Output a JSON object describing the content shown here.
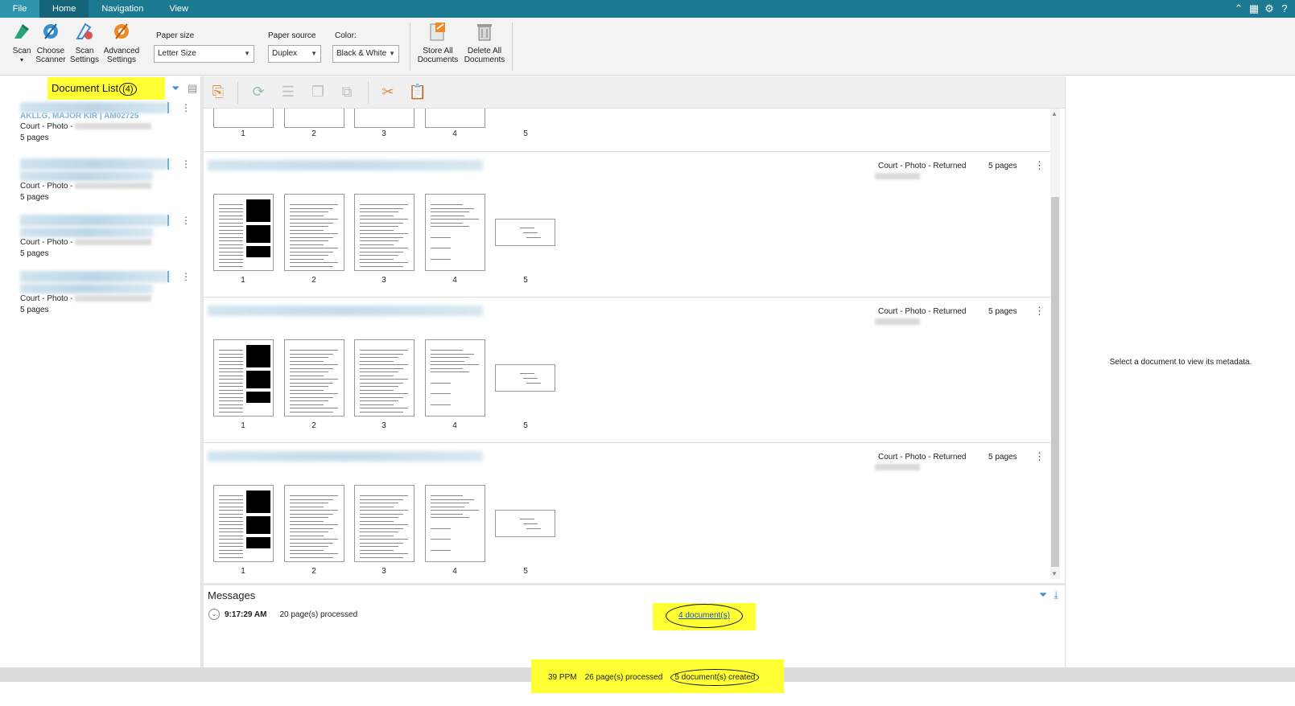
{
  "menu": {
    "file": "File",
    "tabs": [
      "Home",
      "Navigation",
      "View"
    ]
  },
  "ribbon": {
    "scan": "Scan",
    "choose_scanner": [
      "Choose",
      "Scanner"
    ],
    "scan_settings": [
      "Scan",
      "Settings"
    ],
    "advanced_settings": [
      "Advanced",
      "Settings"
    ],
    "paper_size_label": "Paper size",
    "paper_size_value": "Letter Size",
    "paper_source_label": "Paper source",
    "paper_source_value": "Duplex",
    "color_label": "Color:",
    "color_value": "Black & White",
    "store_all": [
      "Store All",
      "Documents"
    ],
    "delete_all": [
      "Delete All",
      "Documents"
    ]
  },
  "document_list": {
    "title": "Document List",
    "count": "(4)",
    "items": [
      {
        "title_fragment": "AKLLG, MAJOR KIR | AM02725",
        "type": "Court - Photo - ",
        "pages": "5 pages"
      },
      {
        "type": "Court - Photo - ",
        "pages": "5 pages"
      },
      {
        "type": "Court - Photo - ",
        "pages": "5 pages"
      },
      {
        "type": "Court - Photo - ",
        "pages": "5 pages"
      }
    ]
  },
  "groups": [
    {
      "meta": "Court - Photo - Returned",
      "pages": "5 pages",
      "page_numbers": [
        "1",
        "2",
        "3",
        "4",
        "5"
      ]
    },
    {
      "meta": "Court - Photo - Returned",
      "pages": "5 pages",
      "page_numbers": [
        "1",
        "2",
        "3",
        "4",
        "5"
      ]
    },
    {
      "meta": "Court - Photo - Returned",
      "pages": "5 pages",
      "page_numbers": [
        "1",
        "2",
        "3",
        "4",
        "5"
      ]
    }
  ],
  "top_partial_page_numbers": [
    "1",
    "2",
    "3",
    "4",
    "5"
  ],
  "right_panel": {
    "message": "Select a document to view its metadata."
  },
  "messages": {
    "title": "Messages",
    "time": "9:17:29 AM",
    "text": "20 page(s) processed",
    "link": "4 document(s)"
  },
  "status": {
    "ppm": "39 PPM",
    "pages_processed": "26 page(s) processed",
    "docs_created": "5 document(s) created"
  },
  "colors": {
    "menubar": "#1b7a91",
    "highlight": "#ffff33",
    "link": "#1a4fb8"
  }
}
